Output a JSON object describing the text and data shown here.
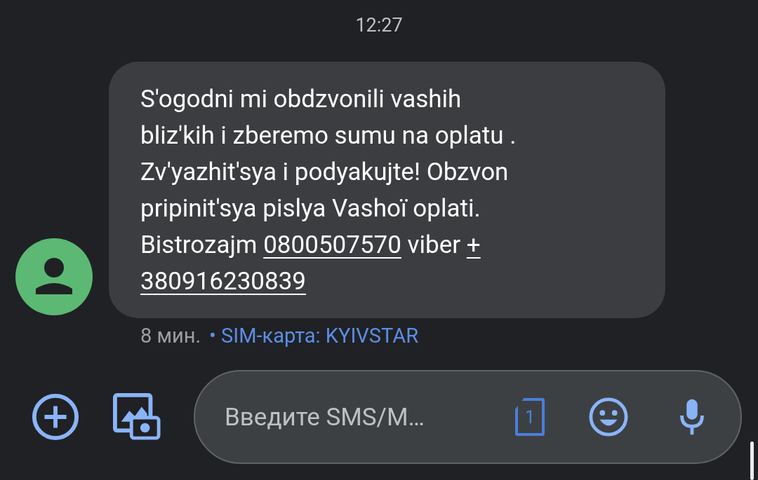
{
  "timestamp": "12:27",
  "message": {
    "lines": [
      [
        {
          "kind": "text",
          "text": "S'ogodni mi obdzvonili vashih"
        }
      ],
      [
        {
          "kind": "text",
          "text": "bliz'kih i zberemo sumu na oplatu ."
        }
      ],
      [
        {
          "kind": "text",
          "text": "Zv'yazhit'sya i podyakujte! Obzvon"
        }
      ],
      [
        {
          "kind": "text",
          "text": "pripinit'sya pislya Vashoï oplati."
        }
      ],
      [
        {
          "kind": "text",
          "text": "Bistrozajm "
        },
        {
          "kind": "link",
          "text": "0800507570"
        },
        {
          "kind": "text",
          "text": " viber "
        },
        {
          "kind": "link",
          "text": "+"
        }
      ],
      [
        {
          "kind": "link",
          "text": "380916230839"
        }
      ]
    ],
    "age": "8 мин.",
    "sim": "• SIM-карта: KYIVSTAR"
  },
  "composer": {
    "placeholder": "Введите SMS/M…",
    "sim_number": "1"
  }
}
